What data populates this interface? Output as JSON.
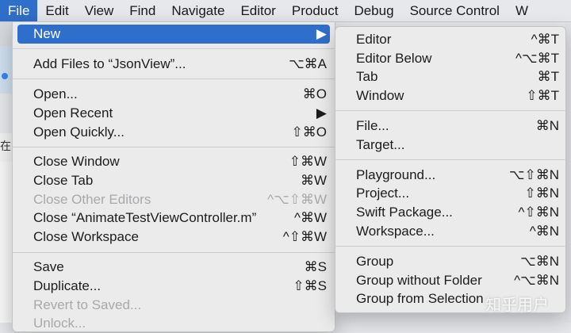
{
  "menubar": {
    "items": [
      "File",
      "Edit",
      "View",
      "Find",
      "Navigate",
      "Editor",
      "Product",
      "Debug",
      "Source Control",
      "W"
    ]
  },
  "file_menu": {
    "new": {
      "label": "New",
      "arrow": "▶"
    },
    "add_files": {
      "label": "Add Files to “JsonView”...",
      "shortcut": "⌥⌘A"
    },
    "open": {
      "label": "Open...",
      "shortcut": "⌘O"
    },
    "open_recent": {
      "label": "Open Recent",
      "arrow": "▶"
    },
    "open_quickly": {
      "label": "Open Quickly...",
      "shortcut": "⇧⌘O"
    },
    "close_window": {
      "label": "Close Window",
      "shortcut": "⇧⌘W"
    },
    "close_tab": {
      "label": "Close Tab",
      "shortcut": "⌘W"
    },
    "close_other_editors": {
      "label": "Close Other Editors",
      "shortcut": "^⌥⇧⌘W"
    },
    "close_file": {
      "label": "Close “AnimateTestViewController.m”",
      "shortcut": "^⌘W"
    },
    "close_workspace": {
      "label": "Close Workspace",
      "shortcut": "^⇧⌘W"
    },
    "save": {
      "label": "Save",
      "shortcut": "⌘S"
    },
    "duplicate": {
      "label": "Duplicate...",
      "shortcut": "⇧⌘S"
    },
    "revert": {
      "label": "Revert to Saved..."
    },
    "unlock": {
      "label": "Unlock..."
    }
  },
  "new_submenu": {
    "editor": {
      "label": "Editor",
      "shortcut": "^⌘T"
    },
    "editor_below": {
      "label": "Editor Below",
      "shortcut": "^⌥⌘T"
    },
    "tab": {
      "label": "Tab",
      "shortcut": "⌘T"
    },
    "window": {
      "label": "Window",
      "shortcut": "⇧⌘T"
    },
    "file": {
      "label": "File...",
      "shortcut": "⌘N"
    },
    "target": {
      "label": "Target..."
    },
    "playground": {
      "label": "Playground...",
      "shortcut": "⌥⇧⌘N"
    },
    "project": {
      "label": "Project...",
      "shortcut": "⇧⌘N"
    },
    "swift_package": {
      "label": "Swift Package...",
      "shortcut": "^⇧⌘N"
    },
    "workspace": {
      "label": "Workspace...",
      "shortcut": "^⌘N"
    },
    "group": {
      "label": "Group",
      "shortcut": "⌥⌘N"
    },
    "group_without_folder": {
      "label": "Group without Folder",
      "shortcut": "^⌥⌘N"
    },
    "group_from_selection": {
      "label": "Group from Selection"
    }
  },
  "background": {
    "side_glyph": "在",
    "watermark": "知乎用户"
  },
  "colors": {
    "highlight": "#2f6ecb",
    "menu_bg": "#ebebec",
    "disabled": "#a9a9ab"
  }
}
